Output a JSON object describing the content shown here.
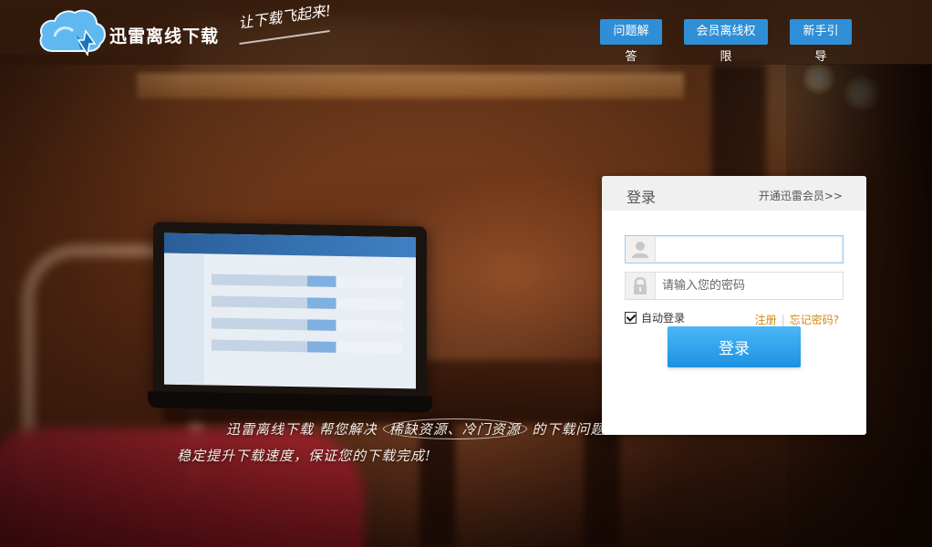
{
  "header": {
    "logo_text": "迅雷离线下载",
    "tagline": "让下载飞起来!",
    "nav": [
      "问题解答",
      "会员离线权限",
      "新手引导"
    ]
  },
  "hero": {
    "slogan_line1_a": "迅雷离线下载 帮您解决",
    "slogan_line1_hl": "稀缺资源、冷门资源",
    "slogan_line1_b": "的下载问题",
    "slogan_line2": "稳定提升下载速度，保证您的下载完成!"
  },
  "login": {
    "title": "登录",
    "vip_link": "开通迅雷会员>>",
    "username_value": "",
    "password_placeholder": "请输入您的密码",
    "remember_label": "自动登录",
    "remember_checked": true,
    "register_link": "注册",
    "separator": "|",
    "forgot_link": "忘记密码?",
    "submit_label": "登录"
  },
  "colors": {
    "accent": "#2f8fd6",
    "link": "#d28a10"
  }
}
